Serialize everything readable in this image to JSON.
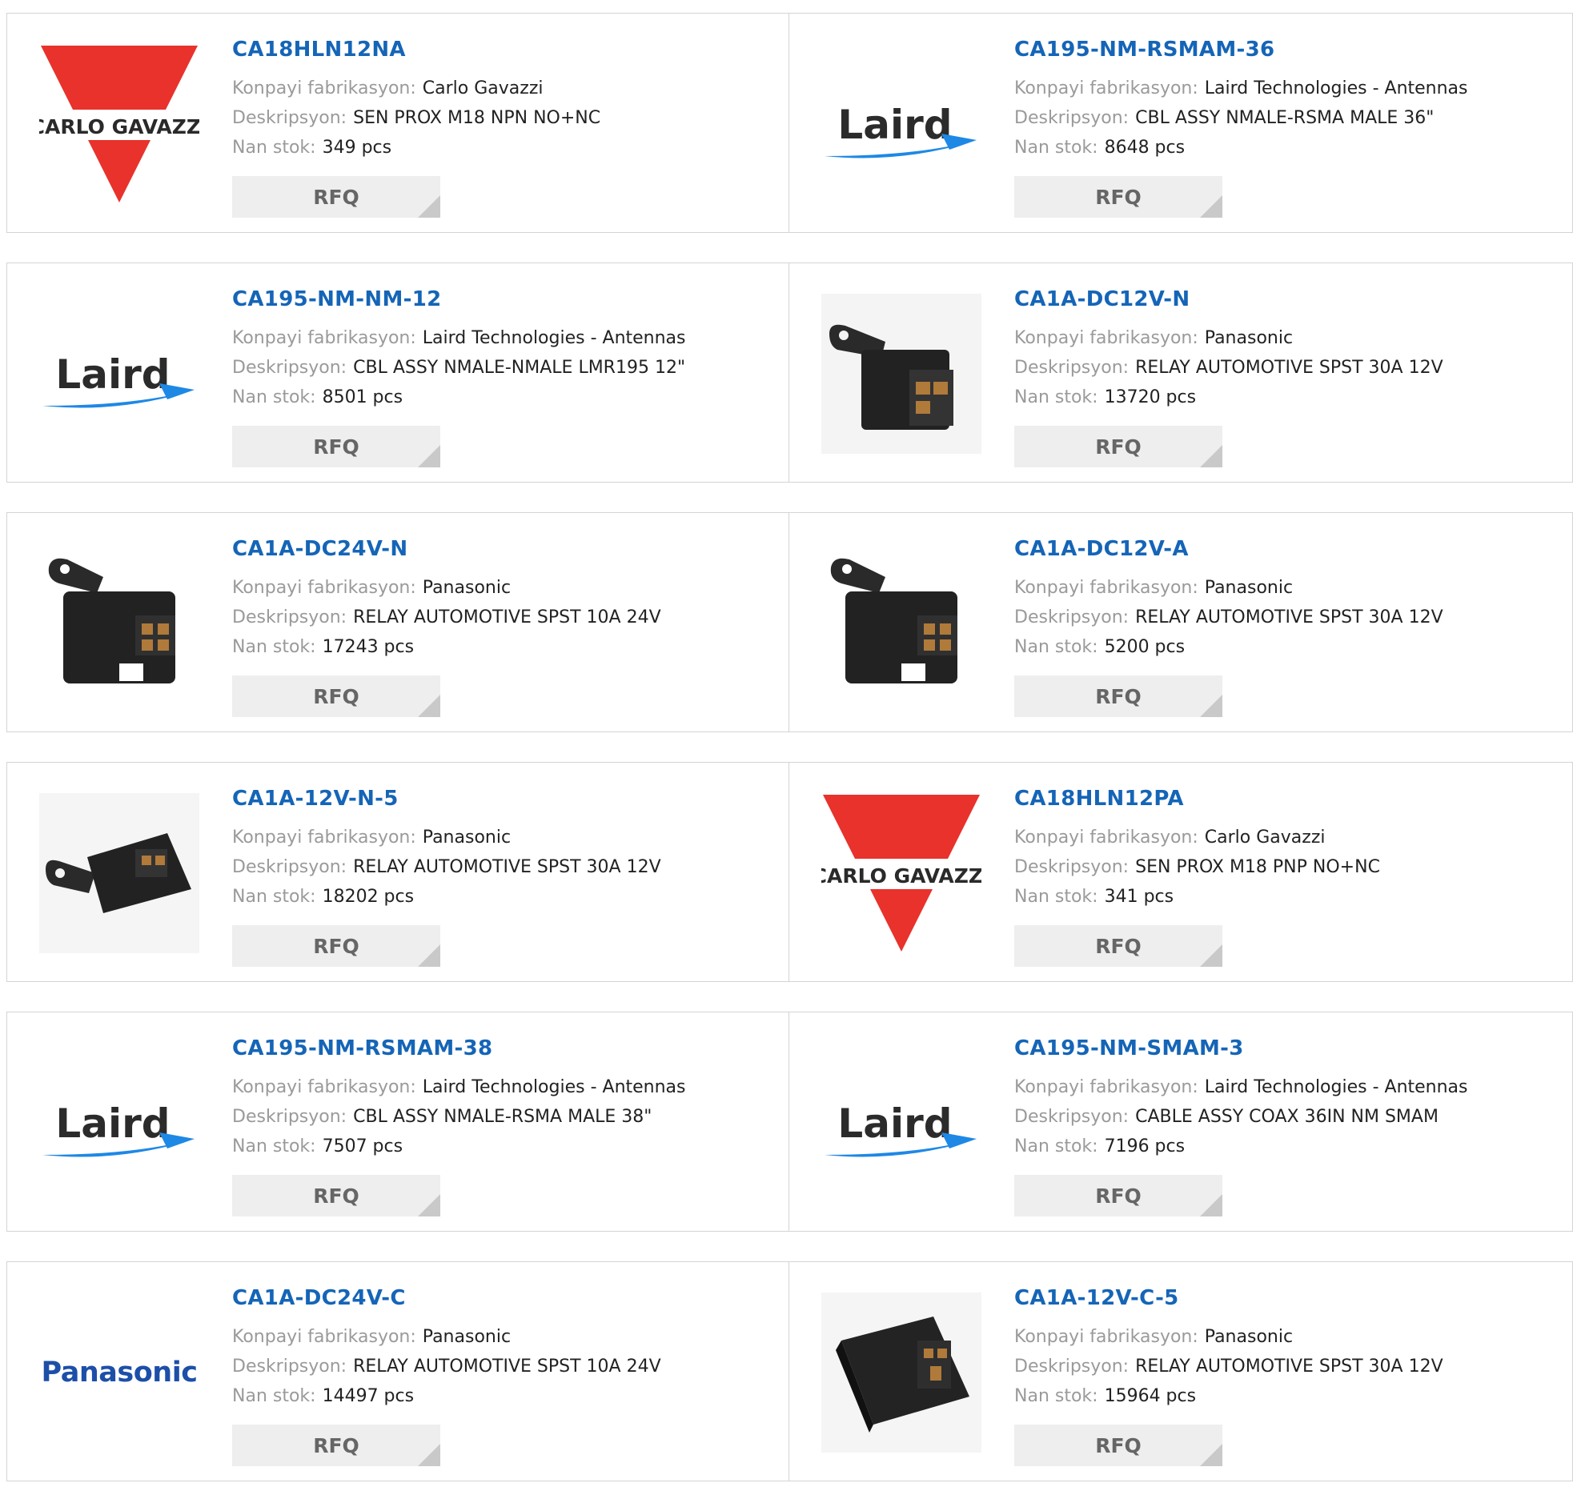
{
  "labels": {
    "manufacturer": "Konpayi fabrikasyon:",
    "description": "Deskripsyon:",
    "stock": "Nan stok:",
    "rfq": "RFQ"
  },
  "colors": {
    "part_link": "#1565b7",
    "carlo_gavazzi_red": "#e8322b",
    "laird_blue": "#1e88e5",
    "panasonic_blue": "#1d4fa8"
  },
  "brand_logos": {
    "carlo_gavazzi": "CARLO GAVAZZI",
    "laird": "Laird",
    "panasonic": "Panasonic"
  },
  "products": [
    {
      "part": "CA18HLN12NA",
      "manufacturer": "Carlo Gavazzi",
      "description": "SEN PROX M18 NPN NO+NC",
      "stock": "349 pcs",
      "image": "carlo-gavazzi-logo"
    },
    {
      "part": "CA195-NM-RSMAM-36",
      "manufacturer": "Laird Technologies - Antennas",
      "description": "CBL ASSY NMALE-RSMA MALE 36\"",
      "stock": "8648 pcs",
      "image": "laird-logo"
    },
    {
      "part": "CA195-NM-NM-12",
      "manufacturer": "Laird Technologies - Antennas",
      "description": "CBL ASSY NMALE-NMALE LMR195 12\"",
      "stock": "8501 pcs",
      "image": "laird-logo"
    },
    {
      "part": "CA1A-DC12V-N",
      "manufacturer": "Panasonic",
      "description": "RELAY AUTOMOTIVE SPST 30A 12V",
      "stock": "13720 pcs",
      "image": "relay-photo-bracket"
    },
    {
      "part": "CA1A-DC24V-N",
      "manufacturer": "Panasonic",
      "description": "RELAY AUTOMOTIVE SPST 10A 24V",
      "stock": "17243 pcs",
      "image": "relay-photo-bracket"
    },
    {
      "part": "CA1A-DC12V-A",
      "manufacturer": "Panasonic",
      "description": "RELAY AUTOMOTIVE SPST 30A 12V",
      "stock": "5200 pcs",
      "image": "relay-photo-bracket"
    },
    {
      "part": "CA1A-12V-N-5",
      "manufacturer": "Panasonic",
      "description": "RELAY AUTOMOTIVE SPST 30A 12V",
      "stock": "18202 pcs",
      "image": "relay-photo-flat"
    },
    {
      "part": "CA18HLN12PA",
      "manufacturer": "Carlo Gavazzi",
      "description": "SEN PROX M18 PNP NO+NC",
      "stock": "341 pcs",
      "image": "carlo-gavazzi-logo"
    },
    {
      "part": "CA195-NM-RSMAM-38",
      "manufacturer": "Laird Technologies - Antennas",
      "description": "CBL ASSY NMALE-RSMA MALE 38\"",
      "stock": "7507 pcs",
      "image": "laird-logo"
    },
    {
      "part": "CA195-NM-SMAM-3",
      "manufacturer": "Laird Technologies - Antennas",
      "description": "CABLE ASSY COAX 36IN NM SMAM",
      "stock": "7196 pcs",
      "image": "laird-logo"
    },
    {
      "part": "CA1A-DC24V-C",
      "manufacturer": "Panasonic",
      "description": "RELAY AUTOMOTIVE SPST 10A 24V",
      "stock": "14497 pcs",
      "image": "panasonic-logo"
    },
    {
      "part": "CA1A-12V-C-5",
      "manufacturer": "Panasonic",
      "description": "RELAY AUTOMOTIVE SPST 30A 12V",
      "stock": "15964 pcs",
      "image": "relay-photo-block"
    }
  ]
}
